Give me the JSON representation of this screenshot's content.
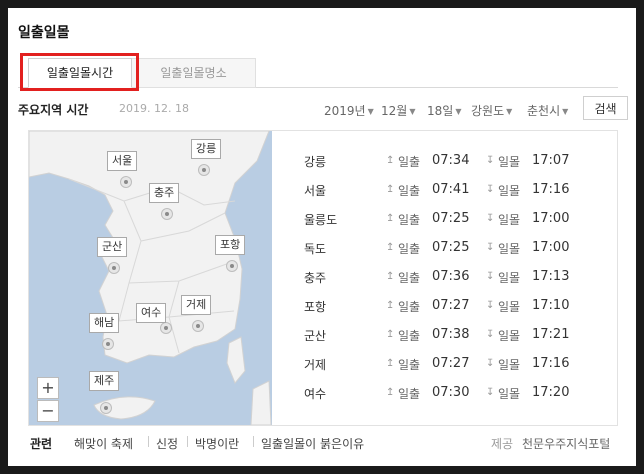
{
  "title": "일출일몰",
  "tabs": [
    {
      "label": "일출일몰시간",
      "active": true
    },
    {
      "label": "일출일몰명소",
      "active": false
    }
  ],
  "subbar": {
    "label": "주요지역 시간",
    "date": "2019. 12. 18",
    "year": "2019년",
    "month": "12월",
    "day": "18일",
    "province": "강원도",
    "city": "춘천시",
    "search_label": "검색"
  },
  "map": {
    "pins": [
      {
        "name": "서울"
      },
      {
        "name": "강릉"
      },
      {
        "name": "충주"
      },
      {
        "name": "군산"
      },
      {
        "name": "포항"
      },
      {
        "name": "여수"
      },
      {
        "name": "거제"
      },
      {
        "name": "해남"
      },
      {
        "name": "제주"
      }
    ],
    "zoom_in": "+",
    "zoom_out": "−"
  },
  "sun": {
    "sunrise_label": "일출",
    "sunset_label": "일몰",
    "up_arrow": "↥",
    "down_arrow": "↧"
  },
  "rows": [
    {
      "city": "강릉",
      "sunrise": "07:34",
      "sunset": "17:07"
    },
    {
      "city": "서울",
      "sunrise": "07:41",
      "sunset": "17:16"
    },
    {
      "city": "울릉도",
      "sunrise": "07:25",
      "sunset": "17:00"
    },
    {
      "city": "독도",
      "sunrise": "07:25",
      "sunset": "17:00"
    },
    {
      "city": "충주",
      "sunrise": "07:36",
      "sunset": "17:13"
    },
    {
      "city": "포항",
      "sunrise": "07:27",
      "sunset": "17:10"
    },
    {
      "city": "군산",
      "sunrise": "07:38",
      "sunset": "17:21"
    },
    {
      "city": "거제",
      "sunrise": "07:27",
      "sunset": "17:16"
    },
    {
      "city": "여수",
      "sunrise": "07:30",
      "sunset": "17:20"
    }
  ],
  "footer": {
    "related_label": "관련",
    "links": [
      "해맞이 축제",
      "신정",
      "박명이란",
      "일출일몰이 붉은이유"
    ],
    "provider_label": "제공",
    "provider": "천문우주지식포털"
  },
  "colors": {
    "highlight": "#e2201f",
    "sea": "#b9cde3",
    "land": "#f2f2f2"
  }
}
